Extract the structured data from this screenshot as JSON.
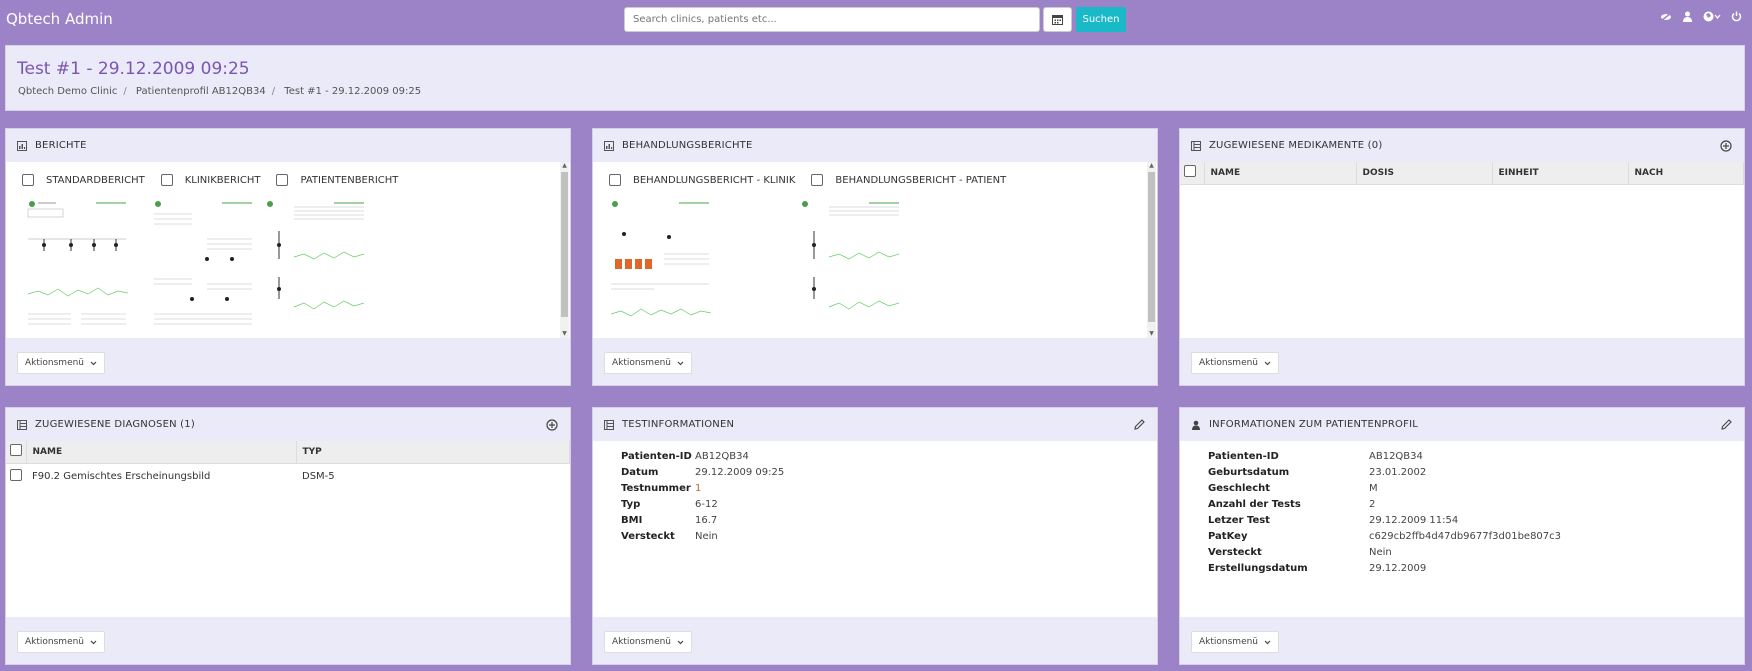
{
  "app": {
    "title": "Qbtech Admin"
  },
  "search": {
    "placeholder": "Search clinics, patients etc...",
    "button": "Suchen"
  },
  "page": {
    "title": "Test #1 - 29.12.2009 09:25",
    "breadcrumb": [
      "Qbtech Demo Clinic",
      "Patientenprofil AB12QB34",
      "Test #1 - 29.12.2009 09:25"
    ]
  },
  "action_label": "Aktionsmenü",
  "berichte": {
    "title": "BERICHTE",
    "items": [
      "STANDARDBERICHT",
      "KLINIKBERICHT",
      "PATIENTENBERICHT"
    ]
  },
  "behandlung": {
    "title": "BEHANDLUNGSBERICHTE",
    "items": [
      "BEHANDLUNGSBERICHT - KLINIK",
      "BEHANDLUNGSBERICHT - PATIENT"
    ]
  },
  "medikamente": {
    "title": "ZUGEWIESENE MEDIKAMENTE (0)",
    "columns": [
      "NAME",
      "DOSIS",
      "EINHEIT",
      "NACH"
    ]
  },
  "diagnosen": {
    "title": "ZUGEWIESENE DIAGNOSEN (1)",
    "columns": [
      "NAME",
      "TYP"
    ],
    "rows": [
      {
        "name": "F90.2 Gemischtes Erscheinungsbild",
        "typ": "DSM-5"
      }
    ]
  },
  "testinfo": {
    "title": "TESTINFORMATIONEN",
    "rows": [
      {
        "k": "Patienten-ID",
        "v": "AB12QB34"
      },
      {
        "k": "Datum",
        "v": "29.12.2009 09:25"
      },
      {
        "k": "Testnummer",
        "v": "1"
      },
      {
        "k": "Typ",
        "v": "6-12"
      },
      {
        "k": "BMI",
        "v": "16.7"
      },
      {
        "k": "Versteckt",
        "v": "Nein"
      }
    ]
  },
  "profil": {
    "title": "INFORMATIONEN ZUM PATIENTENPROFIL",
    "rows": [
      {
        "k": "Patienten-ID",
        "v": "AB12QB34"
      },
      {
        "k": "Geburtsdatum",
        "v": "23.01.2002"
      },
      {
        "k": "Geschlecht",
        "v": "M"
      },
      {
        "k": "Anzahl der Tests",
        "v": "2"
      },
      {
        "k": "Letzer Test",
        "v": "29.12.2009 11:54"
      },
      {
        "k": "PatKey",
        "v": "c629cb2ffb4d47db9677f3d01be807c3"
      },
      {
        "k": "Versteckt",
        "v": "Nein"
      },
      {
        "k": "Erstellungsdatum",
        "v": "29.12.2009"
      }
    ]
  },
  "colors": {
    "background": "#9c82c6",
    "accent": "#7a55b2",
    "link": "#9d7fcf",
    "search_button": "#19b9c8"
  }
}
